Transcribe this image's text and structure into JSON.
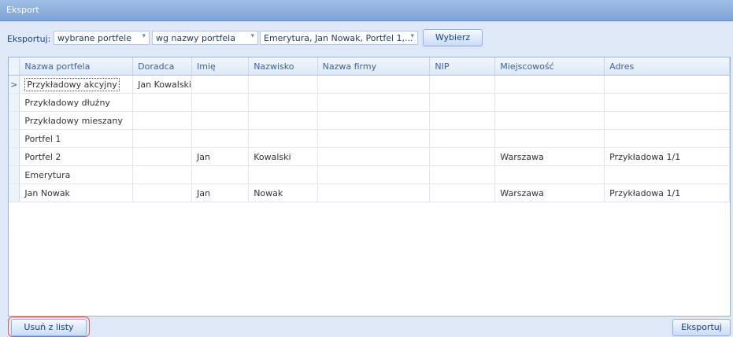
{
  "window": {
    "title": "Eksport"
  },
  "toolbar": {
    "export_label": "Eksportuj:",
    "mode_value": "wybrane portfele",
    "sort_value": "wg nazwy portfela",
    "portfolios_value": "Emerytura, Jan Nowak, Portfel 1,...",
    "choose_label": "Wybierz"
  },
  "table": {
    "columns": [
      "Nazwa portfela",
      "Doradca",
      "Imię",
      "Nazwisko",
      "Nazwa firmy",
      "NIP",
      "Miejscowość",
      "Adres"
    ],
    "rows": [
      [
        "Przykładowy akcyjny",
        "Jan Kowalski",
        "",
        "",
        "",
        "",
        "",
        ""
      ],
      [
        "Przykładowy dłużny",
        "",
        "",
        "",
        "",
        "",
        "",
        ""
      ],
      [
        "Przykładowy mieszany",
        "",
        "",
        "",
        "",
        "",
        "",
        ""
      ],
      [
        "Portfel 1",
        "",
        "",
        "",
        "",
        "",
        "",
        ""
      ],
      [
        "Portfel 2",
        "",
        "Jan",
        "Kowalski",
        "",
        "",
        "Warszawa",
        "Przykładowa 1/1"
      ],
      [
        "Emerytura",
        "",
        "",
        "",
        "",
        "",
        "",
        ""
      ],
      [
        "Jan Nowak",
        "",
        "Jan",
        "Nowak",
        "",
        "",
        "Warszawa",
        "Przykładowa 1/1"
      ]
    ],
    "current_row_indicator": ">"
  },
  "footer": {
    "remove_label": "Usuń z listy",
    "export_button_label": "Eksportuj"
  },
  "colors": {
    "title_bar": "#7ea4d8",
    "highlight_ring": "#e05656"
  },
  "icons": {
    "dropdown": "chevron-down-icon",
    "row_indicator": "row-pointer-icon"
  }
}
